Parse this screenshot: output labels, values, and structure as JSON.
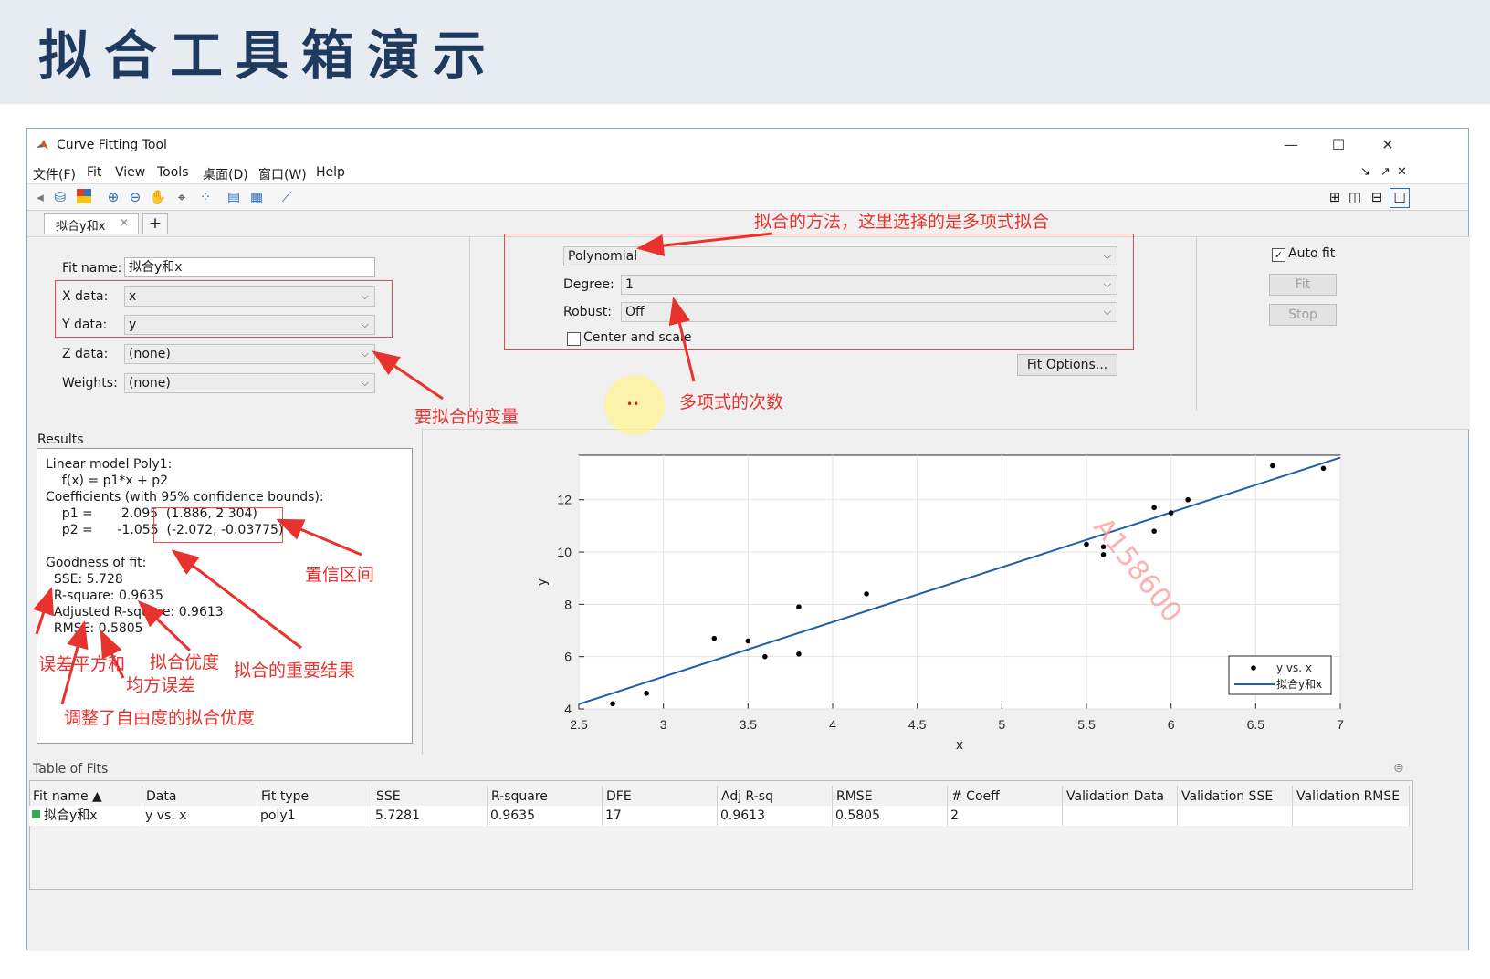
{
  "slide": {
    "title": "拟合工具箱演示"
  },
  "window": {
    "title": "Curve Fitting Tool",
    "minimize": "—",
    "maximize": "☐",
    "close": "✕"
  },
  "menu": [
    "文件(F)",
    "Fit",
    "View",
    "Tools",
    "桌面(D)",
    "窗口(W)",
    "Help"
  ],
  "menu_right": [
    "↘",
    "↗",
    "✕"
  ],
  "tab": {
    "label": "拟合y和x",
    "close": "✕",
    "add": "+"
  },
  "fit": {
    "name_label": "Fit name:",
    "name_value": "拟合y和x",
    "x_label": "X data:",
    "x_value": "x",
    "y_label": "Y data:",
    "y_value": "y",
    "z_label": "Z data:",
    "z_value": "(none)",
    "weights_label": "Weights:",
    "weights_value": "(none)"
  },
  "method": {
    "type": "Polynomial",
    "degree_label": "Degree:",
    "degree_value": "1",
    "robust_label": "Robust:",
    "robust_value": "Off",
    "center_label": "Center and scale",
    "fit_options": "Fit Options..."
  },
  "controls": {
    "autofit_label": "Auto fit",
    "fit": "Fit",
    "stop": "Stop"
  },
  "annotations": {
    "method": "拟合的方法，这里选择的是多项式拟合",
    "vars": "要拟合的变量",
    "degree": "多项式的次数",
    "ci": "置信区间",
    "sse": "误差平方和",
    "rsq": "拟合优度",
    "rmse": "均方误差",
    "results": "拟合的重要结果",
    "adjrsq": "调整了自由度的拟合优度"
  },
  "results": {
    "title": "Results",
    "lines": [
      "Linear model Poly1:",
      "    f(x) = p1*x + p2",
      "Coefficients (with 95% confidence bounds):",
      "    p1 =       2.095  (1.886, 2.304)",
      "    p2 =      -1.055  (-2.072, -0.03775)",
      "",
      "Goodness of fit:",
      "  SSE: 5.728",
      "  R-square: 0.9635",
      "  Adjusted R-square: 0.9613",
      "  RMSE: 0.5805"
    ]
  },
  "chart_data": {
    "type": "scatter",
    "xlabel": "x",
    "ylabel": "y",
    "xlim": [
      2.5,
      7
    ],
    "ylim": [
      4,
      13.7
    ],
    "xticks": [
      "2.5",
      "3",
      "3.5",
      "4",
      "4.5",
      "5",
      "5.5",
      "6",
      "6.5",
      "7"
    ],
    "yticks": [
      "4",
      "6",
      "8",
      "10",
      "12"
    ],
    "grid": true,
    "legend_position": "bottom-right",
    "series": [
      {
        "name": "y vs. x",
        "points": [
          [
            2.7,
            4.2
          ],
          [
            2.9,
            4.6
          ],
          [
            3.3,
            6.7
          ],
          [
            3.5,
            6.6
          ],
          [
            3.6,
            6.0
          ],
          [
            3.8,
            6.1
          ],
          [
            3.8,
            7.9
          ],
          [
            4.2,
            8.4
          ],
          [
            5.5,
            10.3
          ],
          [
            5.6,
            10.2
          ],
          [
            5.6,
            9.9
          ],
          [
            5.9,
            11.7
          ],
          [
            5.9,
            10.8
          ],
          [
            6.0,
            11.5
          ],
          [
            6.1,
            12.0
          ],
          [
            6.6,
            13.3
          ],
          [
            6.9,
            13.2
          ]
        ],
        "color": "#000000"
      },
      {
        "name": "拟合y和x",
        "line": {
          "p1": 2.095,
          "p2": -1.055
        },
        "color": "#1f5fa9"
      }
    ]
  },
  "table": {
    "title": "Table of Fits",
    "headers": [
      "Fit name ▲",
      "Data",
      "Fit type",
      "SSE",
      "R-square",
      "DFE",
      "Adj R-sq",
      "RMSE",
      "# Coeff",
      "Validation Data",
      "Validation SSE",
      "Validation RMSE"
    ],
    "row": [
      "拟合y和x",
      "y vs. x",
      "poly1",
      "5.7281",
      "0.9635",
      "17",
      "0.9613",
      "0.5805",
      "2",
      "",
      "",
      ""
    ]
  },
  "watermark": "A158600"
}
